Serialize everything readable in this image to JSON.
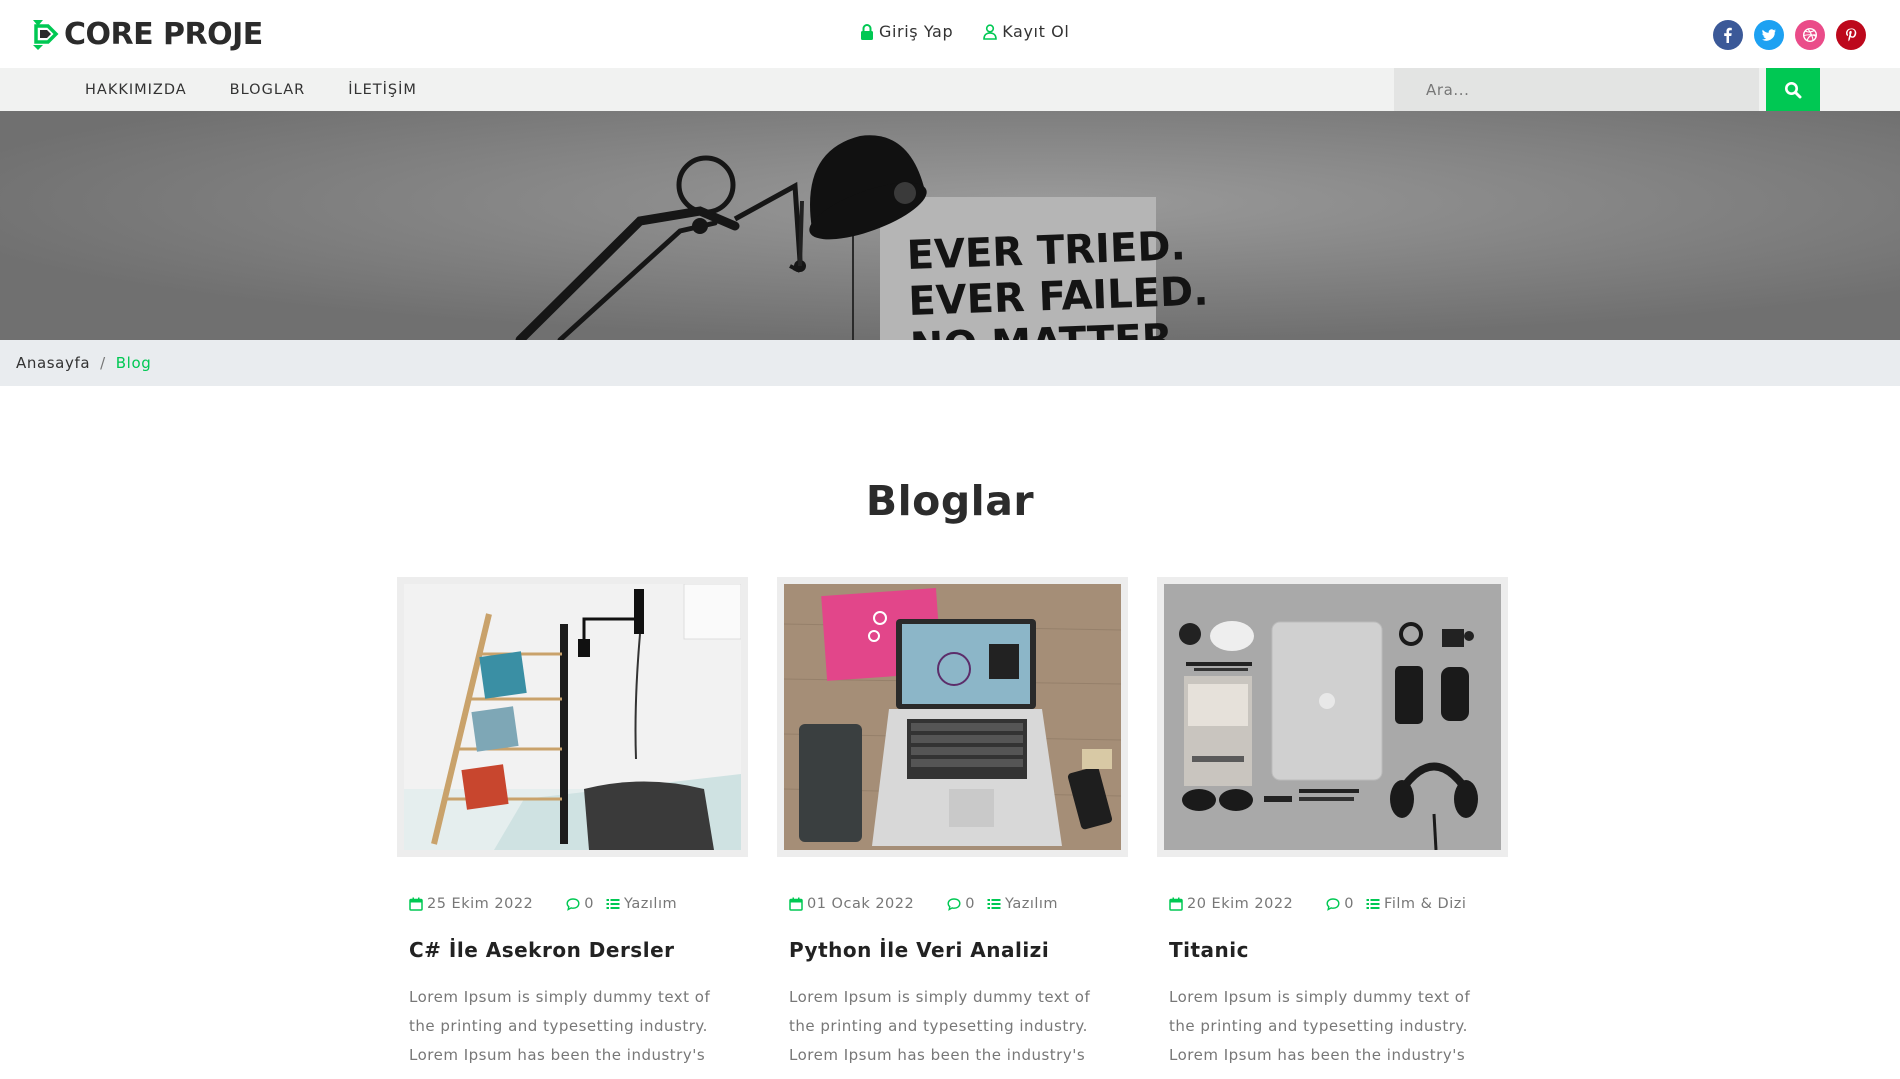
{
  "header": {
    "logo_text": "CORE PROJE",
    "login_label": "Giriş Yap",
    "register_label": "Kayıt Ol",
    "social": [
      {
        "name": "facebook-icon",
        "color": "#3b5998"
      },
      {
        "name": "twitter-icon",
        "color": "#1da1f2"
      },
      {
        "name": "dribbble-icon",
        "color": "#ea4c89"
      },
      {
        "name": "pinterest-icon",
        "color": "#bd081c"
      }
    ]
  },
  "nav": {
    "items": [
      "HAKKIMIZDA",
      "BLOGLAR",
      "İLETİŞİM"
    ],
    "search_placeholder": "Ara..."
  },
  "hero": {
    "text": "EVER TRIED.\nEVER FAILED.\nNO MATTER"
  },
  "breadcrumb": {
    "home": "Anasayfa",
    "separator": "/",
    "current": "Blog"
  },
  "section": {
    "title": "Bloglar"
  },
  "posts": [
    {
      "date": "25 Ekim 2022",
      "comments": "0",
      "category": "Yazılım",
      "title": "C# İle Asekron Dersler",
      "excerpt": "Lorem Ipsum is simply dummy text of the printing and typesetting industry. Lorem Ipsum has been the industry's"
    },
    {
      "date": "01 Ocak 2022",
      "comments": "0",
      "category": "Yazılım",
      "title": "Python İle Veri Analizi",
      "excerpt": "Lorem Ipsum is simply dummy text of the printing and typesetting industry. Lorem Ipsum has been the industry's"
    },
    {
      "date": "20 Ekim 2022",
      "comments": "0",
      "category": "Film & Dizi",
      "title": "Titanic",
      "excerpt": "Lorem Ipsum is simply dummy text of the printing and typesetting industry. Lorem Ipsum has been the industry's"
    }
  ],
  "colors": {
    "accent": "#00c853",
    "text_dark": "#2c2c2c",
    "text_muted": "#777777"
  }
}
